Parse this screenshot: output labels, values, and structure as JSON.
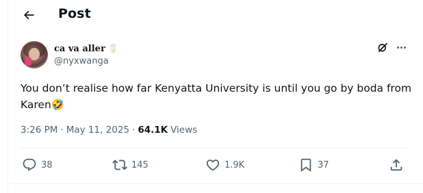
{
  "header": {
    "title": "Post",
    "back_icon": "arrow-left-icon"
  },
  "author": {
    "display_name": "ca va aller",
    "name_emoji": "🥛",
    "handle": "@nyxwanga"
  },
  "tweet": {
    "text": "You don’t realise how far Kenyatta University is until you go by boda from Karen🤣"
  },
  "meta": {
    "time": "3:26 PM",
    "separator": "·",
    "date": "May 11, 2025",
    "views_count": "64.1K",
    "views_label": "Views"
  },
  "actions": {
    "replies": "38",
    "reposts": "145",
    "likes": "1.9K",
    "bookmarks": "37"
  },
  "colors": {
    "text_primary": "#0f1419",
    "text_secondary": "#536471",
    "border": "#eff3f4"
  }
}
